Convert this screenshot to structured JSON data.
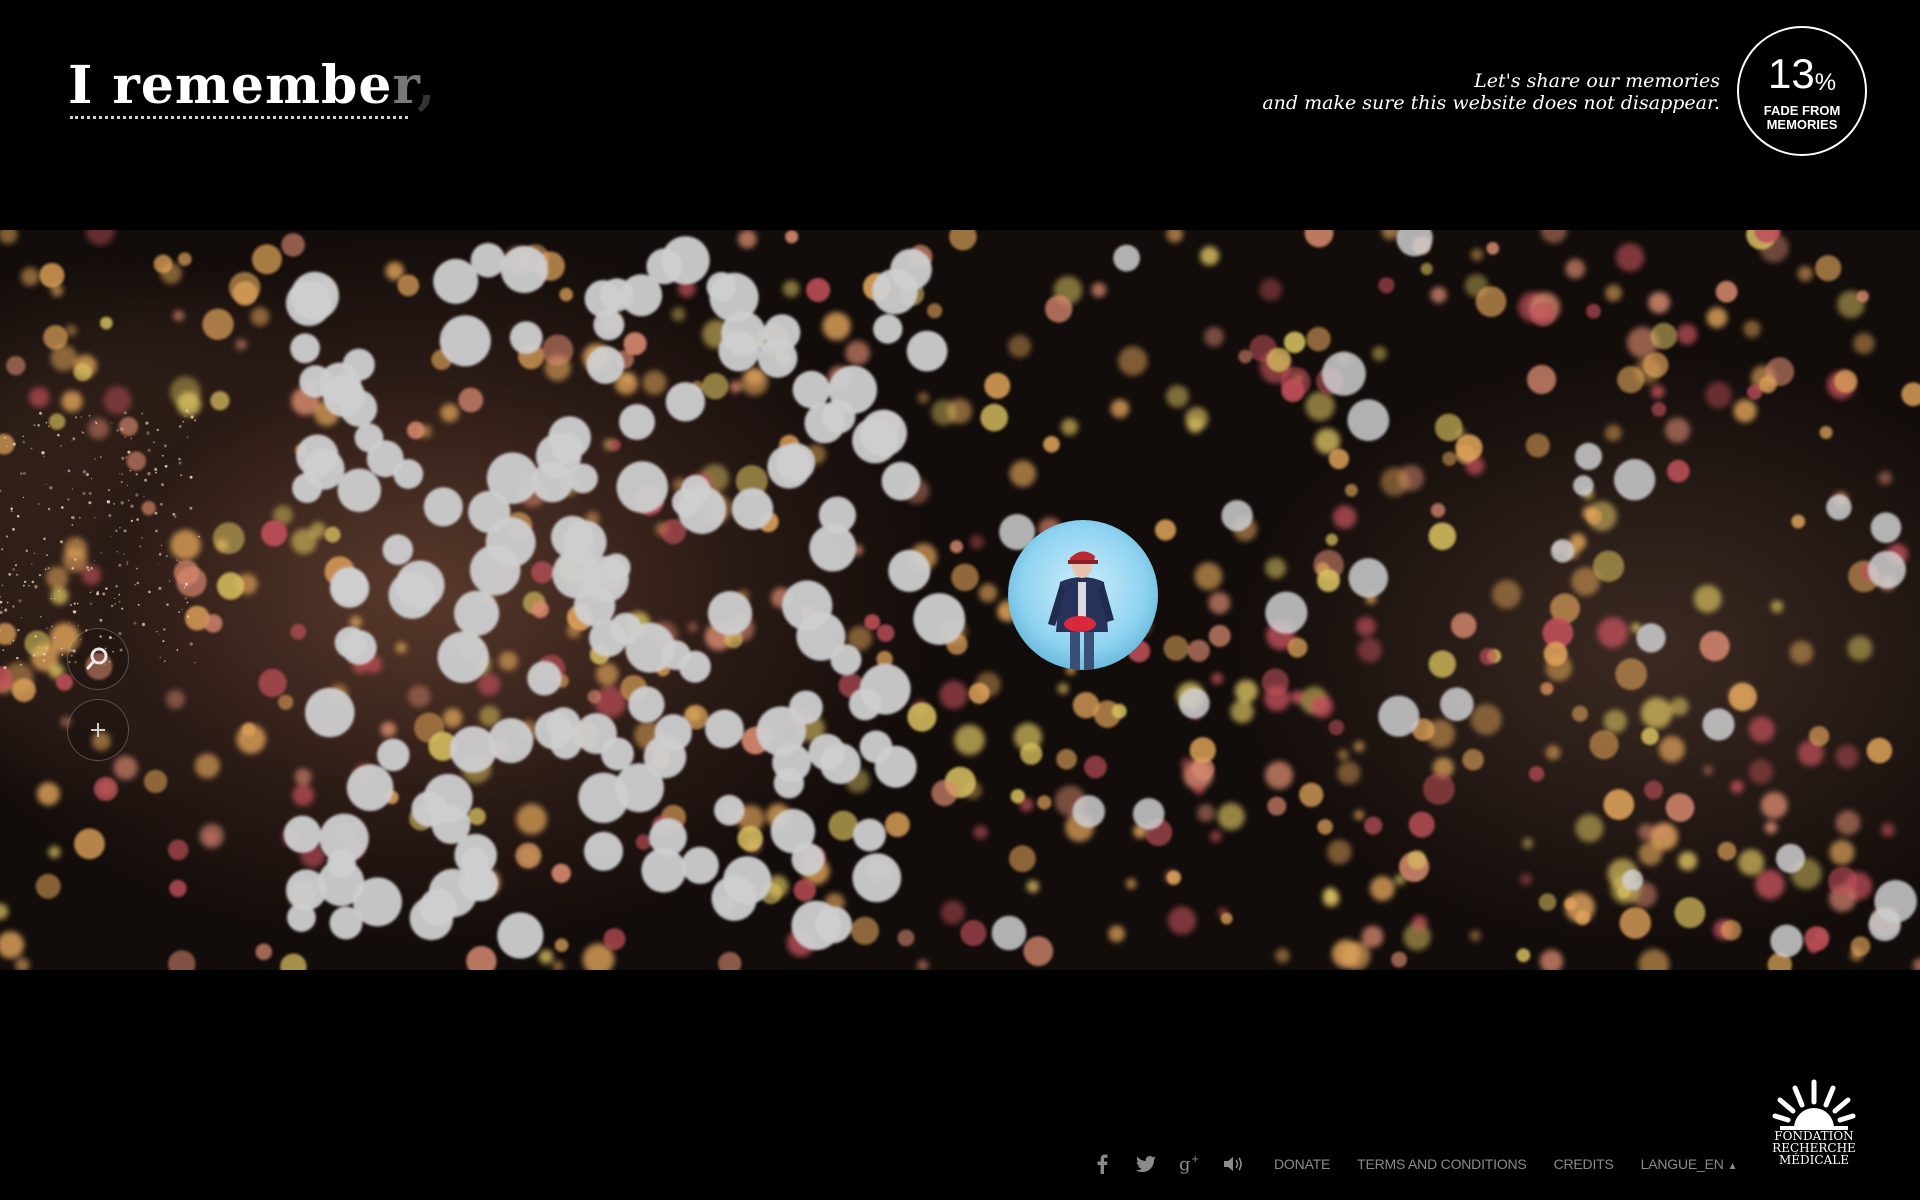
{
  "header": {
    "brand_main": "I remembe",
    "brand_fade_1": "r",
    "brand_fade_2": ",",
    "tagline_line_1": "Let's share our memories",
    "tagline_line_2": "and make sure this website does not disappear.",
    "fade_badge": {
      "percent_value": "13",
      "percent_sign": "%",
      "caption_line_1": "FADE FROM",
      "caption_line_2": "MEMORIES"
    }
  },
  "memory_field": {
    "featured_memory_icon": "person-photo",
    "tools": [
      {
        "name": "search-button",
        "icon": "magnifier-icon"
      },
      {
        "name": "add-memory-button",
        "icon": "plus-icon"
      }
    ],
    "colors": {
      "grey_bubble": "#cfcfd0",
      "amber_bubble": "#e0a45a",
      "gold_bubble": "#d8c060",
      "salmon_bubble": "#d98a70",
      "red_bubble": "#c0505a",
      "featured_glow": "#8fd3f1"
    }
  },
  "footer": {
    "social_icons": [
      "facebook-icon",
      "twitter-icon",
      "google-plus-icon",
      "sound-icon"
    ],
    "links": {
      "donate": "DONATE",
      "terms": "TERMS AND CONDITIONS",
      "credits": "CREDITS",
      "language": "LANGUE_EN"
    },
    "logo": {
      "line_1": "FONDATION",
      "line_2": "RECHERCHE",
      "line_3": "MÉDICALE"
    }
  }
}
